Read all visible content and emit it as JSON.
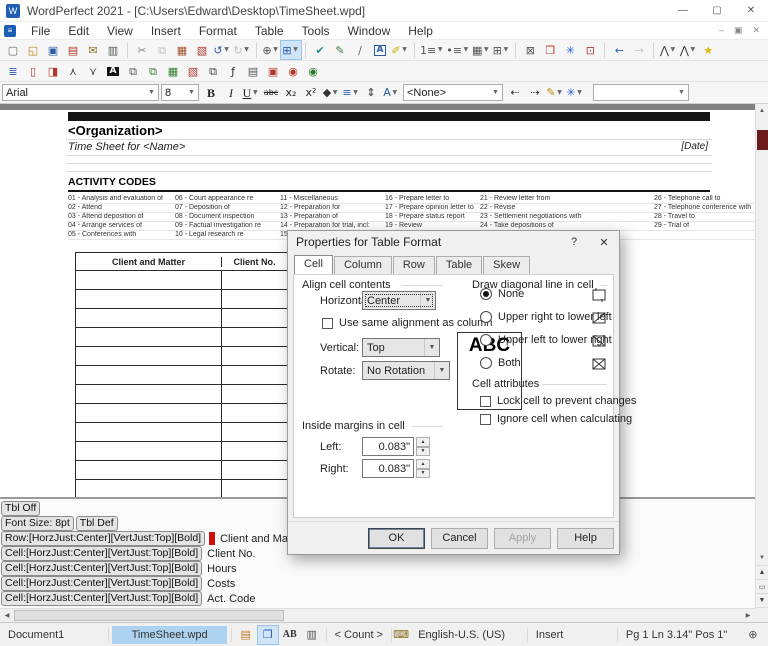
{
  "titlebar": {
    "title": "WordPerfect 2021 - [C:\\Users\\Edward\\Desktop\\TimeSheet.wpd]",
    "minimize": "—",
    "maximize": "▢",
    "close": "✕"
  },
  "menubar": {
    "items": [
      "File",
      "Edit",
      "View",
      "Insert",
      "Format",
      "Table",
      "Tools",
      "Window",
      "Help"
    ],
    "mdi": [
      "–",
      "▣",
      "✕"
    ]
  },
  "toolbar1": [
    {
      "n": "new-document-icon",
      "g": "▢",
      "c": "#666"
    },
    {
      "n": "open-icon",
      "g": "◱",
      "c": "#b8860b"
    },
    {
      "n": "save-icon",
      "g": "▣",
      "c": "#2a5caa"
    },
    {
      "n": "print-pdf-icon",
      "g": "▤",
      "c": "#b03a2e"
    },
    {
      "n": "envelope-icon",
      "g": "✉",
      "c": "#8a6d1a"
    },
    {
      "n": "print-icon",
      "g": "▥",
      "c": "#555"
    },
    {
      "sep": true
    },
    {
      "n": "cut-icon",
      "g": "✂",
      "c": "#888"
    },
    {
      "n": "copy-icon",
      "g": "⧉",
      "c": "#bdbdbd"
    },
    {
      "n": "paste-icon",
      "g": "▦",
      "c": "#a0522d"
    },
    {
      "n": "paste-special-icon",
      "g": "▧",
      "c": "#b03a2e"
    },
    {
      "n": "undo-icon",
      "g": "↺",
      "c": "#2a5caa",
      "dd": true
    },
    {
      "n": "redo-icon",
      "g": "↻",
      "c": "#bdbdbd",
      "dd": true
    },
    {
      "sep": true
    },
    {
      "n": "zoom-icon",
      "g": "⊕",
      "c": "#555",
      "dd": true
    },
    {
      "n": "page-view-icon",
      "g": "⊞",
      "c": "#2a5caa",
      "dd": true,
      "hl": true
    },
    {
      "sep": true
    },
    {
      "n": "proofread-icon",
      "g": "✔",
      "c": "#2a8a8a"
    },
    {
      "n": "send-icon",
      "g": "✎",
      "c": "#3a7d3a"
    },
    {
      "n": "draw-line-icon",
      "g": "∕",
      "c": "#666"
    },
    {
      "n": "text-box-icon",
      "g": "A",
      "c": "#2a5caa",
      "box": true
    },
    {
      "n": "highlight-icon",
      "g": "✐",
      "c": "#c8a800",
      "dd": true
    },
    {
      "sep": true
    },
    {
      "n": "numbered-list-icon",
      "g": "1≡",
      "c": "#555",
      "dd": true
    },
    {
      "n": "bullet-list-icon",
      "g": "•≡",
      "c": "#555",
      "dd": true
    },
    {
      "n": "table-icon",
      "g": "▦",
      "c": "#555",
      "dd": true
    },
    {
      "n": "table-quickcreate-icon",
      "g": "⊞",
      "c": "#555",
      "dd": true
    },
    {
      "sep": true
    },
    {
      "n": "frame-icon",
      "g": "⊠",
      "c": "#555"
    },
    {
      "n": "dictionary-icon",
      "g": "❒",
      "c": "#b03a2e"
    },
    {
      "n": "quickfinder-icon",
      "g": "✳",
      "c": "#2a5cd0"
    },
    {
      "n": "table-format-icon",
      "g": "⊡",
      "c": "#b03a2e"
    },
    {
      "sep": true
    },
    {
      "n": "back-icon",
      "g": "←",
      "c": "#2a5caa"
    },
    {
      "n": "forward-icon",
      "g": "→",
      "c": "#c7c7c7"
    },
    {
      "sep": true
    },
    {
      "n": "macro-icon",
      "g": "⋀",
      "c": "#333",
      "dd": true
    },
    {
      "n": "macro-edit-icon",
      "g": "⋀",
      "c": "#333",
      "dd": true
    },
    {
      "n": "favorites-icon",
      "g": "★",
      "c": "#e3b505"
    }
  ],
  "toolbar2": [
    {
      "n": "justify-icon",
      "g": "≣",
      "c": "#2a5caa"
    },
    {
      "n": "page-border-icon",
      "g": "▯",
      "c": "#b03a2e"
    },
    {
      "n": "envelope-merge-icon",
      "g": "◨",
      "c": "#b03a2e"
    },
    {
      "n": "font-up-icon",
      "g": "⋏",
      "c": "#445"
    },
    {
      "n": "font-down-icon",
      "g": "⋎",
      "c": "#445"
    },
    {
      "n": "reverse-text-icon",
      "g": "A",
      "c": "#fff",
      "darkbox": true
    },
    {
      "n": "org-chart-icon",
      "g": "⧉",
      "c": "#556"
    },
    {
      "n": "flow-chart-icon",
      "g": "⧉",
      "c": "#3a7d3a"
    },
    {
      "n": "spreadsheet-icon",
      "g": "▦",
      "c": "#2e7d32"
    },
    {
      "n": "presentation-icon",
      "g": "▧",
      "c": "#b03a2e"
    },
    {
      "n": "copy-format-icon",
      "g": "⧉",
      "c": "#445"
    },
    {
      "n": "function-icon",
      "g": "ƒ",
      "c": "#333"
    },
    {
      "n": "print-preview-icon",
      "g": "▤",
      "c": "#555"
    },
    {
      "n": "save-version-icon",
      "g": "▣",
      "c": "#b03a2e"
    },
    {
      "n": "find-icon",
      "g": "◉",
      "c": "#b03a2e"
    },
    {
      "n": "find-next-icon",
      "g": "◉",
      "c": "#2e7d32"
    }
  ],
  "propbar": {
    "font_name": "Arial",
    "font_size": "8",
    "style_value": "<None>",
    "extra_combo_value": "",
    "group1": [
      {
        "n": "bold-icon",
        "g": "B",
        "cls": "pb-b"
      },
      {
        "n": "italic-icon",
        "g": "I",
        "cls": "pb-i"
      },
      {
        "n": "underline-icon",
        "g": "U",
        "cls": "pb-u",
        "dd": true
      },
      {
        "n": "strikethrough-icon",
        "g": "abc",
        "cls": "pb-strike"
      },
      {
        "n": "subscript-icon",
        "g": "x₂"
      },
      {
        "n": "superscript-icon",
        "g": "x²"
      },
      {
        "n": "font-color-icon",
        "g": "◆",
        "c": "#333",
        "dd": true
      },
      {
        "n": "justification-icon",
        "g": "≡",
        "c": "#2a5caa",
        "dd": true
      },
      {
        "n": "line-spacing-icon",
        "g": "⇕",
        "c": "#333"
      },
      {
        "n": "font-attributes-icon",
        "g": "A",
        "c": "#2a5caa",
        "dd": true
      }
    ],
    "group2": [
      {
        "n": "letterspacing-decrease-icon",
        "g": "⇠",
        "c": "#333"
      },
      {
        "n": "letterspacing-increase-icon",
        "g": "⇢",
        "c": "#333"
      },
      {
        "n": "grammar-pen-icon",
        "g": "✎",
        "c": "#b58a00",
        "dd": true
      },
      {
        "n": "quickwords-icon",
        "g": "✳",
        "c": "#2a5cd0",
        "dd": true
      }
    ]
  },
  "document": {
    "organization": "<Organization>",
    "timesheet_line": "Time Sheet for <Name>",
    "date": "[Date]",
    "activity_title": "ACTIVITY CODES",
    "codes": [
      [
        "01 - Analysis and evaluation of",
        "06 - Court appearance re",
        "11 - Miscellaneous",
        "16 - Prepare letter to",
        "21 - Review letter from",
        "26 - Telephone call to"
      ],
      [
        "02 - Attend",
        "07 - Deposition of",
        "12 - Preparation for",
        "17 - Prepare opinion letter to",
        "22 - Revise",
        "27 - Telephone conference with"
      ],
      [
        "03 - Attend deposition of",
        "08 - Document inspection",
        "13 - Preparation of",
        "18 - Prepare status report",
        "23 - Settlement negotiations with",
        "28 - Travel to"
      ],
      [
        "04 - Arrange services of",
        "09 - Factual investigation re",
        "14 - Preparation for trial, incl:",
        "19 - Review",
        "24 - Take depositions of",
        "29 - Trial of"
      ],
      [
        "05 - Conferences with",
        "10 - Legal research re",
        "15 -",
        "",
        "",
        ""
      ]
    ],
    "table_headers": [
      "Client and Matter",
      "Client No."
    ],
    "table_empty_rows": 12
  },
  "dialog": {
    "title": "Properties for Table Format",
    "help_glyph": "?",
    "close_glyph": "✕",
    "tabs": [
      "Cell",
      "Column",
      "Row",
      "Table",
      "Skew"
    ],
    "active_tab_index": 0,
    "align_group": {
      "label": "Align cell contents",
      "horizontal_label": "Horizontal:",
      "horizontal_value": "Center",
      "same_checkbox": "Use same alignment as column",
      "vertical_label": "Vertical:",
      "vertical_value": "Top",
      "rotate_label": "Rotate:",
      "rotate_value": "No Rotation",
      "preview_text": "ABC"
    },
    "diagonal_group": {
      "label": "Draw diagonal line in cell",
      "options": [
        {
          "label": "None",
          "selected": true,
          "icon": "none"
        },
        {
          "label": "Upper right to lower left",
          "selected": false,
          "icon": "ur-ll"
        },
        {
          "label": "Upper left to lower right",
          "selected": false,
          "icon": "ul-lr"
        },
        {
          "label": "Both",
          "selected": false,
          "icon": "both"
        }
      ]
    },
    "attributes_group": {
      "label": "Cell attributes",
      "checkboxes": [
        "Lock cell to prevent changes",
        "Ignore cell when calculating"
      ]
    },
    "margins_group": {
      "label": "Inside margins in cell",
      "left_label": "Left:",
      "left_value": "0.083\"",
      "right_label": "Right:",
      "right_value": "0.083\""
    },
    "buttons": [
      {
        "label": "OK",
        "default": true
      },
      {
        "label": "Cancel"
      },
      {
        "label": "Apply",
        "disabled": true
      },
      {
        "label": "Help"
      }
    ]
  },
  "reveal_codes": {
    "lines": [
      {
        "tokens": [
          "Tbl Off"
        ],
        "text": "",
        "cursor": false
      },
      {
        "tokens": [
          "Font Size: 8pt",
          "Tbl Def"
        ],
        "text": "",
        "cursor": false
      },
      {
        "tokens": [
          "Row:[HorzJust:Center][VertJust:Top][Bold]"
        ],
        "text": "Client and Matter",
        "cursor": true
      },
      {
        "tokens": [
          "Cell:[HorzJust:Center][VertJust:Top][Bold]"
        ],
        "text": "Client No.",
        "cursor": false
      },
      {
        "tokens": [
          "Cell:[HorzJust:Center][VertJust:Top][Bold]"
        ],
        "text": "Hours",
        "cursor": false
      },
      {
        "tokens": [
          "Cell:[HorzJust:Center][VertJust:Top][Bold]"
        ],
        "text": "Costs",
        "cursor": false
      },
      {
        "tokens": [
          "Cell:[HorzJust:Center][VertJust:Top][Bold]"
        ],
        "text": "Act. Code",
        "cursor": false
      }
    ]
  },
  "scroll": {
    "up": "▲",
    "down": "▼",
    "left": "◀",
    "right": "▶",
    "browse": [
      {
        "n": "previous-page-button",
        "g": "▲"
      },
      {
        "n": "browse-page-button",
        "g": "▭"
      },
      {
        "n": "next-page-button",
        "g": "▼"
      },
      {
        "n": "browse-mode-button",
        "g": "▦"
      }
    ]
  },
  "statusbar": {
    "general_status": "Document1",
    "active_document": "TimeSheet.wpd",
    "icons": [
      {
        "n": "file-status-icon",
        "g": "▤",
        "c": "#c87a2a"
      },
      {
        "n": "open-book-icon",
        "g": "❒",
        "c": "#2a5caa",
        "hl": true
      },
      {
        "n": "caps-status-icon",
        "g": "AB",
        "c": "#333",
        "ab": true
      },
      {
        "n": "printer-status-icon",
        "g": "▥",
        "c": "#555"
      }
    ],
    "count": "< Count >",
    "keyboard_glyph": "⌨",
    "language": "English-U.S. (US)",
    "insert_mode": "Insert",
    "position": "Pg 1 Ln 3.14\" Pos 1\"",
    "zoom_glyph": "⊕"
  }
}
